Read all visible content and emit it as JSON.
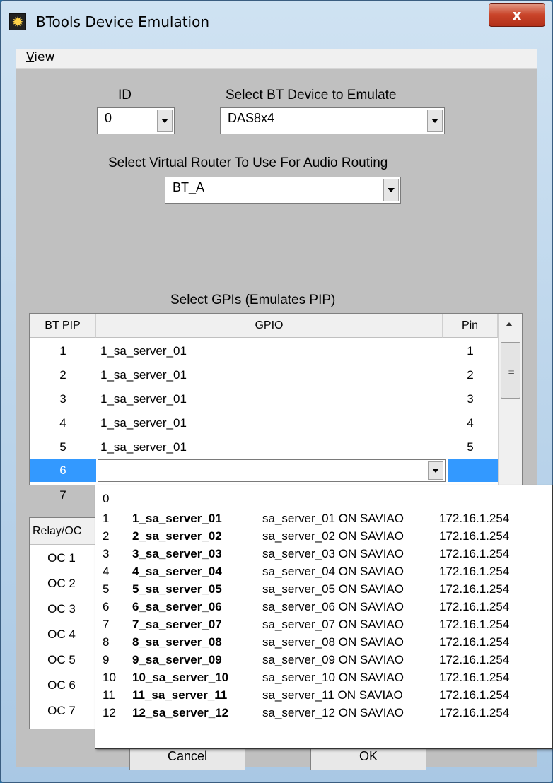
{
  "window": {
    "title": "BTools Device Emulation",
    "close_glyph": "x"
  },
  "menu": {
    "view_first": "V",
    "view_rest": "iew"
  },
  "form": {
    "id_label": "ID",
    "id_value": "0",
    "device_label": "Select BT Device to Emulate",
    "device_value": "DAS8x4",
    "router_label": "Select Virtual Router To Use For Audio Routing",
    "router_value": "BT_A",
    "gpi_title": "Select GPIs (Emulates PIP)"
  },
  "gpi_grid": {
    "headers": [
      "BT PIP",
      "GPIO",
      "Pin"
    ],
    "rows": [
      {
        "pip": "1",
        "gpio": "1_sa_server_01",
        "pin": "1"
      },
      {
        "pip": "2",
        "gpio": "1_sa_server_01",
        "pin": "2"
      },
      {
        "pip": "3",
        "gpio": "1_sa_server_01",
        "pin": "3"
      },
      {
        "pip": "4",
        "gpio": "1_sa_server_01",
        "pin": "4"
      },
      {
        "pip": "5",
        "gpio": "1_sa_server_01",
        "pin": "5"
      },
      {
        "pip": "6",
        "gpio": "",
        "pin": ""
      },
      {
        "pip": "7",
        "gpio": "",
        "pin": ""
      }
    ]
  },
  "relay_grid": {
    "header": "Relay/OC",
    "rows": [
      "OC 1",
      "OC 2",
      "OC 3",
      "OC 4",
      "OC 5",
      "OC 6",
      "OC 7"
    ]
  },
  "dropdown": {
    "items": [
      {
        "index": "0",
        "name": "",
        "desc": "",
        "ip": ""
      },
      {
        "index": "1",
        "name": "1_sa_server_01",
        "desc": "sa_server_01 ON SAVIAO",
        "ip": "172.16.1.254"
      },
      {
        "index": "2",
        "name": "2_sa_server_02",
        "desc": "sa_server_02 ON SAVIAO",
        "ip": "172.16.1.254"
      },
      {
        "index": "3",
        "name": "3_sa_server_03",
        "desc": "sa_server_03 ON SAVIAO",
        "ip": "172.16.1.254"
      },
      {
        "index": "4",
        "name": "4_sa_server_04",
        "desc": "sa_server_04 ON SAVIAO",
        "ip": "172.16.1.254"
      },
      {
        "index": "5",
        "name": "5_sa_server_05",
        "desc": "sa_server_05 ON SAVIAO",
        "ip": "172.16.1.254"
      },
      {
        "index": "6",
        "name": "6_sa_server_06",
        "desc": "sa_server_06 ON SAVIAO",
        "ip": "172.16.1.254"
      },
      {
        "index": "7",
        "name": "7_sa_server_07",
        "desc": "sa_server_07 ON SAVIAO",
        "ip": "172.16.1.254"
      },
      {
        "index": "8",
        "name": "8_sa_server_08",
        "desc": "sa_server_08 ON SAVIAO",
        "ip": "172.16.1.254"
      },
      {
        "index": "9",
        "name": "9_sa_server_09",
        "desc": "sa_server_09 ON SAVIAO",
        "ip": "172.16.1.254"
      },
      {
        "index": "10",
        "name": "10_sa_server_10",
        "desc": "sa_server_10 ON SAVIAO",
        "ip": "172.16.1.254"
      },
      {
        "index": "11",
        "name": "11_sa_server_11",
        "desc": "sa_server_11 ON SAVIAO",
        "ip": "172.16.1.254"
      },
      {
        "index": "12",
        "name": "12_sa_server_12",
        "desc": "sa_server_12 ON SAVIAO",
        "ip": "172.16.1.254"
      }
    ]
  },
  "buttons": {
    "cancel": "Cancel",
    "ok": "OK"
  },
  "colors": {
    "selection": "#3399ff",
    "client_bg": "#c0c0c0"
  }
}
